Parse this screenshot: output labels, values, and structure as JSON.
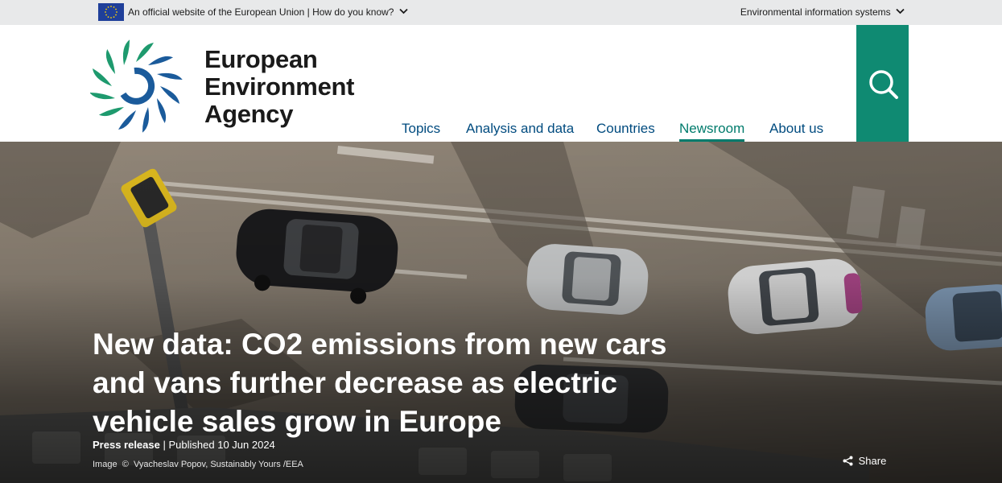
{
  "eu_bar": {
    "official_text": "An official website of the European Union",
    "separator": "|",
    "how_know": "How do you know?",
    "env_systems": "Environmental information systems"
  },
  "header": {
    "brand_line1": "European",
    "brand_line2": "Environment",
    "brand_line3": "Agency",
    "nav": [
      {
        "label": "Topics"
      },
      {
        "label": "Analysis and data"
      },
      {
        "label": "Countries"
      },
      {
        "label": "Newsroom",
        "active": true
      },
      {
        "label": "About us"
      }
    ],
    "search_icon": "search-icon"
  },
  "hero": {
    "headline": "New data: CO2 emissions from new cars and vans further decrease as electric vehicle sales grow in Europe",
    "type": "Press release",
    "separator": "|",
    "published": "Published 10 Jun 2024",
    "credit_prefix": "Image",
    "credit_symbol": "©",
    "credit_text": "Vyacheslav Popov, Sustainably Yours /EEA",
    "share_label": "Share"
  },
  "colors": {
    "accent_teal": "#0f8a72",
    "nav_blue": "#004b7f",
    "active_green": "#007b6c",
    "eu_blue": "#1f3f9a"
  }
}
